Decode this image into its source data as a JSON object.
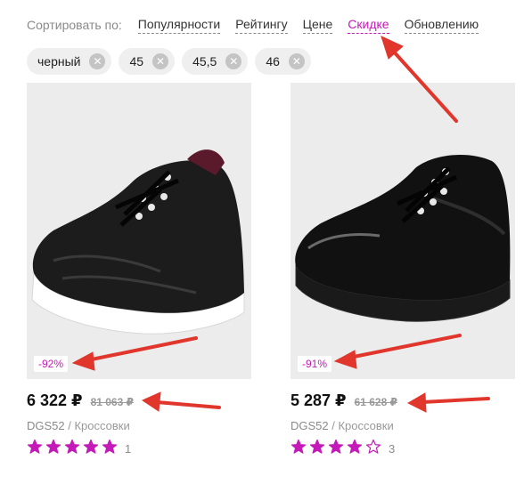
{
  "sort": {
    "caption": "Сортировать по:",
    "options": [
      {
        "label": "Популярности",
        "active": false
      },
      {
        "label": "Рейтингу",
        "active": false
      },
      {
        "label": "Цене",
        "active": false
      },
      {
        "label": "Скидке",
        "active": true
      },
      {
        "label": "Обновлению",
        "active": false
      }
    ]
  },
  "filters": [
    {
      "label": "черный",
      "remove_icon": "close-icon"
    },
    {
      "label": "45",
      "remove_icon": "close-icon"
    },
    {
      "label": "45,5",
      "remove_icon": "close-icon"
    },
    {
      "label": "46",
      "remove_icon": "close-icon"
    }
  ],
  "products": [
    {
      "discount": "-92%",
      "price": "6 322 ₽",
      "old_price": "81 063 ₽",
      "brand": "DGS52",
      "separator": " / ",
      "category": "Кроссовки",
      "rating": 5,
      "rating_count": "1",
      "sole_color": "#ffffff"
    },
    {
      "discount": "-91%",
      "price": "5 287 ₽",
      "old_price": "61 628 ₽",
      "brand": "DGS52",
      "separator": " / ",
      "category": "Кроссовки",
      "rating": 4,
      "rating_count": "3",
      "sole_color": "#1a1a1a"
    }
  ],
  "colors": {
    "accent": "#c41ab8",
    "annotation_arrow": "#e0362c"
  }
}
